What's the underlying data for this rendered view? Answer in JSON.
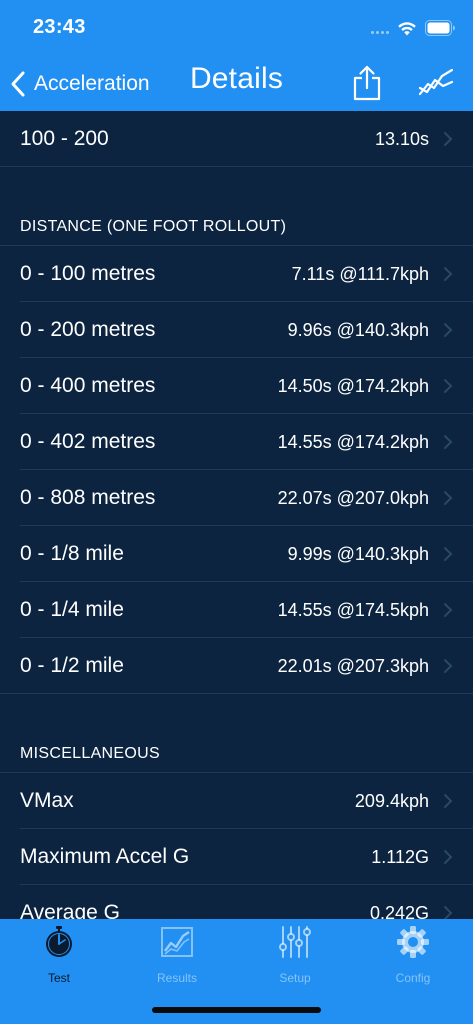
{
  "status_bar": {
    "time": "23:43"
  },
  "nav": {
    "back_label": "Acceleration",
    "title": "Details"
  },
  "top_rows": [
    {
      "label": "100 - 200",
      "value": "13.10s"
    }
  ],
  "distance_section": {
    "header": "DISTANCE (ONE FOOT ROLLOUT)",
    "rows": [
      {
        "label": "0 - 100 metres",
        "value": "7.11s @111.7kph"
      },
      {
        "label": "0 - 200 metres",
        "value": "9.96s @140.3kph"
      },
      {
        "label": "0 - 400 metres",
        "value": "14.50s @174.2kph"
      },
      {
        "label": "0 - 402 metres",
        "value": "14.55s @174.2kph"
      },
      {
        "label": "0 - 808 metres",
        "value": "22.07s @207.0kph"
      },
      {
        "label": "0 - 1/8 mile",
        "value": "9.99s @140.3kph"
      },
      {
        "label": "0 - 1/4 mile",
        "value": "14.55s @174.5kph"
      },
      {
        "label": "0 - 1/2 mile",
        "value": "22.01s @207.3kph"
      }
    ]
  },
  "misc_section": {
    "header": "MISCELLANEOUS",
    "rows": [
      {
        "label": "VMax",
        "value": "209.4kph"
      },
      {
        "label": "Maximum Accel G",
        "value": "1.112G"
      },
      {
        "label": "Average G",
        "value": "0.242G"
      }
    ]
  },
  "tabbar": {
    "tabs": [
      {
        "label": "Test",
        "icon": "stopwatch-icon",
        "active": true
      },
      {
        "label": "Results",
        "icon": "chart-icon",
        "active": false
      },
      {
        "label": "Setup",
        "icon": "sliders-icon",
        "active": false
      },
      {
        "label": "Config",
        "icon": "gear-icon",
        "active": false
      }
    ]
  },
  "colors": {
    "header_blue": "#2190f2",
    "background_navy": "#0c2440",
    "separator": "#1e3a58",
    "active_tab": "#0c1a2e"
  }
}
